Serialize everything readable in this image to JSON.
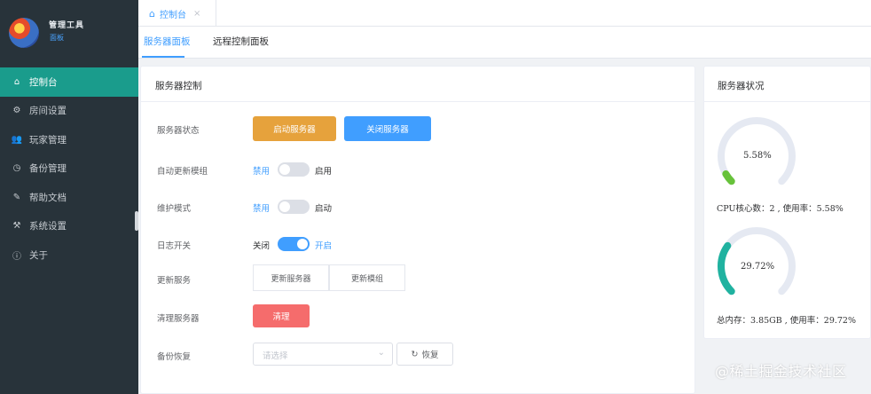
{
  "sidebar": {
    "logo_line1": "管理工具",
    "logo_line2": "面板",
    "items": [
      {
        "label": "控制台",
        "icon": "home-icon",
        "glyph": "⌂"
      },
      {
        "label": "房间设置",
        "icon": "gear-icon",
        "glyph": "⚙"
      },
      {
        "label": "玩家管理",
        "icon": "users-icon",
        "glyph": "👥"
      },
      {
        "label": "备份管理",
        "icon": "clock-icon",
        "glyph": "◷"
      },
      {
        "label": "帮助文档",
        "icon": "document-icon",
        "glyph": "✎"
      },
      {
        "label": "系统设置",
        "icon": "tools-icon",
        "glyph": "⚒"
      },
      {
        "label": "关于",
        "icon": "info-icon",
        "glyph": "ⓘ"
      }
    ],
    "active_index": 0
  },
  "tabbar": {
    "tab_label": "控制台",
    "close_glyph": "×"
  },
  "subtabs": [
    "服务器面板",
    "远程控制面板"
  ],
  "control_card": {
    "title": "服务器控制",
    "rows": {
      "server_label": "服务器状态",
      "start_button": "启动服务器",
      "stop_button": "关闭服务器",
      "auto_update_label": "自动更新模组",
      "auto_update_off": "禁用",
      "auto_update_on": "启用",
      "maintain_label": "维护模式",
      "maintain_off": "禁用",
      "maintain_on": "启动",
      "log_label": "日志开关",
      "log_off": "关闭",
      "log_on": "开启",
      "update_label": "更新服务",
      "update_btn1": "更新服务器",
      "update_btn2": "更新模组",
      "clear_label": "清理服务器",
      "clear_btn": "清理",
      "restore_label": "备份恢复",
      "restore_placeholder": "请选择",
      "restore_btn": "恢复"
    }
  },
  "status_card": {
    "title": "服务器状况",
    "cpu_percent_label": "5.58%",
    "cpu_percent": 5.58,
    "cpu_line": "CPU核心数：2 , 使用率：5.58%",
    "mem_percent_label": "29.72%",
    "mem_percent": 29.72,
    "mem_line": "总内存：3.85GB , 使用率：29.72%",
    "cpu_color": "#67c23a",
    "mem_color": "#20b2a0",
    "track_color": "#e5e9f2"
  },
  "watermark": "@稀土掘金技术社区"
}
